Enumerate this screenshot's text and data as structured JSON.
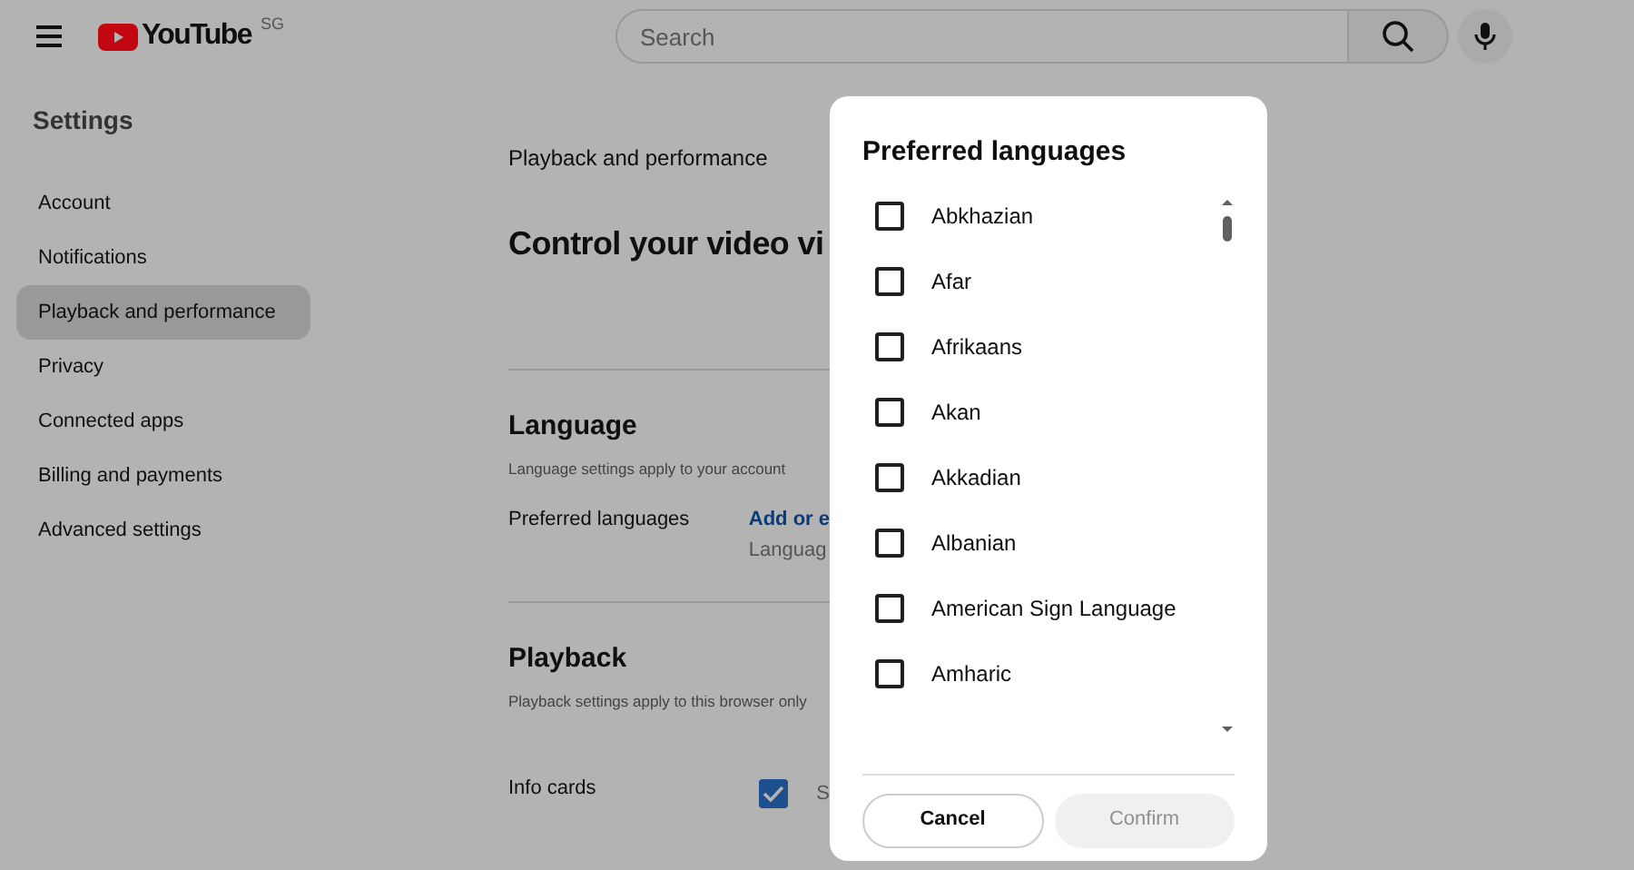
{
  "header": {
    "logo": "YouTube",
    "region": "SG",
    "search": {
      "placeholder": "Search"
    }
  },
  "sidebar": {
    "title": "Settings",
    "items": [
      {
        "label": "Account",
        "selected": false
      },
      {
        "label": "Notifications",
        "selected": false
      },
      {
        "label": "Playback and performance",
        "selected": true
      },
      {
        "label": "Privacy",
        "selected": false
      },
      {
        "label": "Connected apps",
        "selected": false
      },
      {
        "label": "Billing and payments",
        "selected": false
      },
      {
        "label": "Advanced settings",
        "selected": false
      }
    ]
  },
  "main": {
    "breadcrumb": "Playback and performance",
    "heading": "Control your video vi",
    "sections": [
      {
        "title": "Language",
        "subtitle": "Language settings apply to your account",
        "rows": [
          {
            "kind": "link",
            "label": "Preferred languages",
            "link": "Add or e",
            "note": "Languag"
          }
        ]
      },
      {
        "title": "Playback",
        "subtitle": "Playback settings apply to this browser only",
        "rows": [
          {
            "kind": "checkbox",
            "label": "Info cards",
            "checked": true,
            "text": "S"
          }
        ]
      }
    ]
  },
  "dialog": {
    "title": "Preferred languages",
    "options": [
      {
        "label": "Abkhazian",
        "checked": false
      },
      {
        "label": "Afar",
        "checked": false
      },
      {
        "label": "Afrikaans",
        "checked": false
      },
      {
        "label": "Akan",
        "checked": false
      },
      {
        "label": "Akkadian",
        "checked": false
      },
      {
        "label": "Albanian",
        "checked": false
      },
      {
        "label": "American Sign Language",
        "checked": false
      },
      {
        "label": "Amharic",
        "checked": false
      }
    ],
    "buttons": [
      {
        "label": "Cancel",
        "disabled": false
      },
      {
        "label": "Confirm",
        "disabled": true
      }
    ]
  }
}
